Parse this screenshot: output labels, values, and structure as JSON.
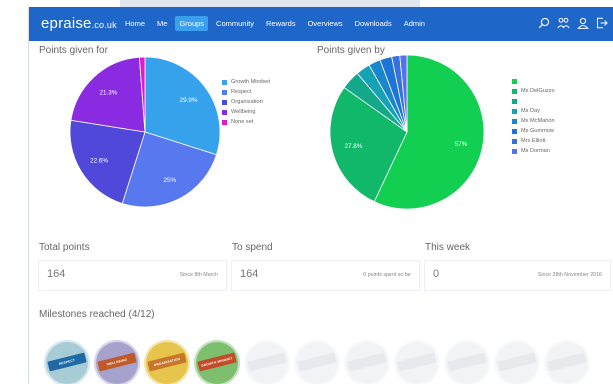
{
  "app": {
    "logo_main": "epraise",
    "logo_suffix": ".co.uk"
  },
  "nav": {
    "items": [
      {
        "label": "Home"
      },
      {
        "label": "Me"
      },
      {
        "label": "Groups",
        "active": true
      },
      {
        "label": "Community"
      },
      {
        "label": "Rewards"
      },
      {
        "label": "Overviews"
      },
      {
        "label": "Downloads"
      },
      {
        "label": "Admin"
      }
    ],
    "icons": [
      "search-icon",
      "users-icon",
      "user-icon",
      "logout-icon"
    ]
  },
  "points_given_for": {
    "title": "Points given for"
  },
  "points_given_by": {
    "title": "Points given by"
  },
  "chart_data": [
    {
      "type": "pie",
      "title": "Points given for",
      "categories": [
        "Growth Mindset",
        "Respect",
        "Organisation",
        "Wellbeing",
        "None set"
      ],
      "values": [
        29.9,
        25,
        22.6,
        21.3,
        1.2
      ],
      "labels": [
        "29.9%",
        "25%",
        "22.6%",
        "21.3%",
        ""
      ],
      "colors": [
        "#36a2eb",
        "#5878ef",
        "#5048d8",
        "#8a2be2",
        "#dd1ec8"
      ],
      "legend": "right"
    },
    {
      "type": "pie",
      "title": "Points given by",
      "categories": [
        "",
        "Ms DelGuzzo",
        "",
        "Ms Day",
        "Ms McMahon",
        "Ms Gummow",
        "Mrs Elliott",
        "Ms Dorman"
      ],
      "values": [
        57,
        27.8,
        4,
        3,
        2.5,
        2.5,
        1.7,
        1.5
      ],
      "labels": [
        "57%",
        "27.8%",
        "",
        "",
        "",
        "",
        "",
        ""
      ],
      "colors": [
        "#12cf52",
        "#12b86a",
        "#14a88a",
        "#16a2b4",
        "#1a86cc",
        "#1d73d6",
        "#3572de",
        "#5572e6"
      ],
      "legend": "right"
    }
  ],
  "stats": {
    "total": {
      "title": "Total points",
      "value": "164",
      "note": "Since 8th March"
    },
    "spend": {
      "title": "To spend",
      "value": "164",
      "note": "0 points spent so far"
    },
    "week": {
      "title": "This week",
      "value": "0",
      "note": "Since 28th November 2016"
    }
  },
  "milestones": {
    "title": "Milestones reached (4/12)",
    "badges": [
      {
        "label": "RESPECT",
        "achieved": true,
        "bg": "#a8ccd6",
        "ribbon": "#1f6aa6"
      },
      {
        "label": "WELLBEING",
        "achieved": true,
        "bg": "#a7a2cc",
        "ribbon": "#c05a2a"
      },
      {
        "label": "ORGANISATION",
        "achieved": true,
        "bg": "#e6c54c",
        "ribbon": "#c8772a"
      },
      {
        "label": "GROWTH MINDSET",
        "achieved": true,
        "bg": "#7dbf6e",
        "ribbon": "#c44b2a"
      },
      {
        "label": "",
        "achieved": false
      },
      {
        "label": "",
        "achieved": false
      },
      {
        "label": "",
        "achieved": false
      },
      {
        "label": "",
        "achieved": false
      },
      {
        "label": "",
        "achieved": false
      },
      {
        "label": "",
        "achieved": false
      },
      {
        "label": "",
        "achieved": false
      }
    ]
  }
}
